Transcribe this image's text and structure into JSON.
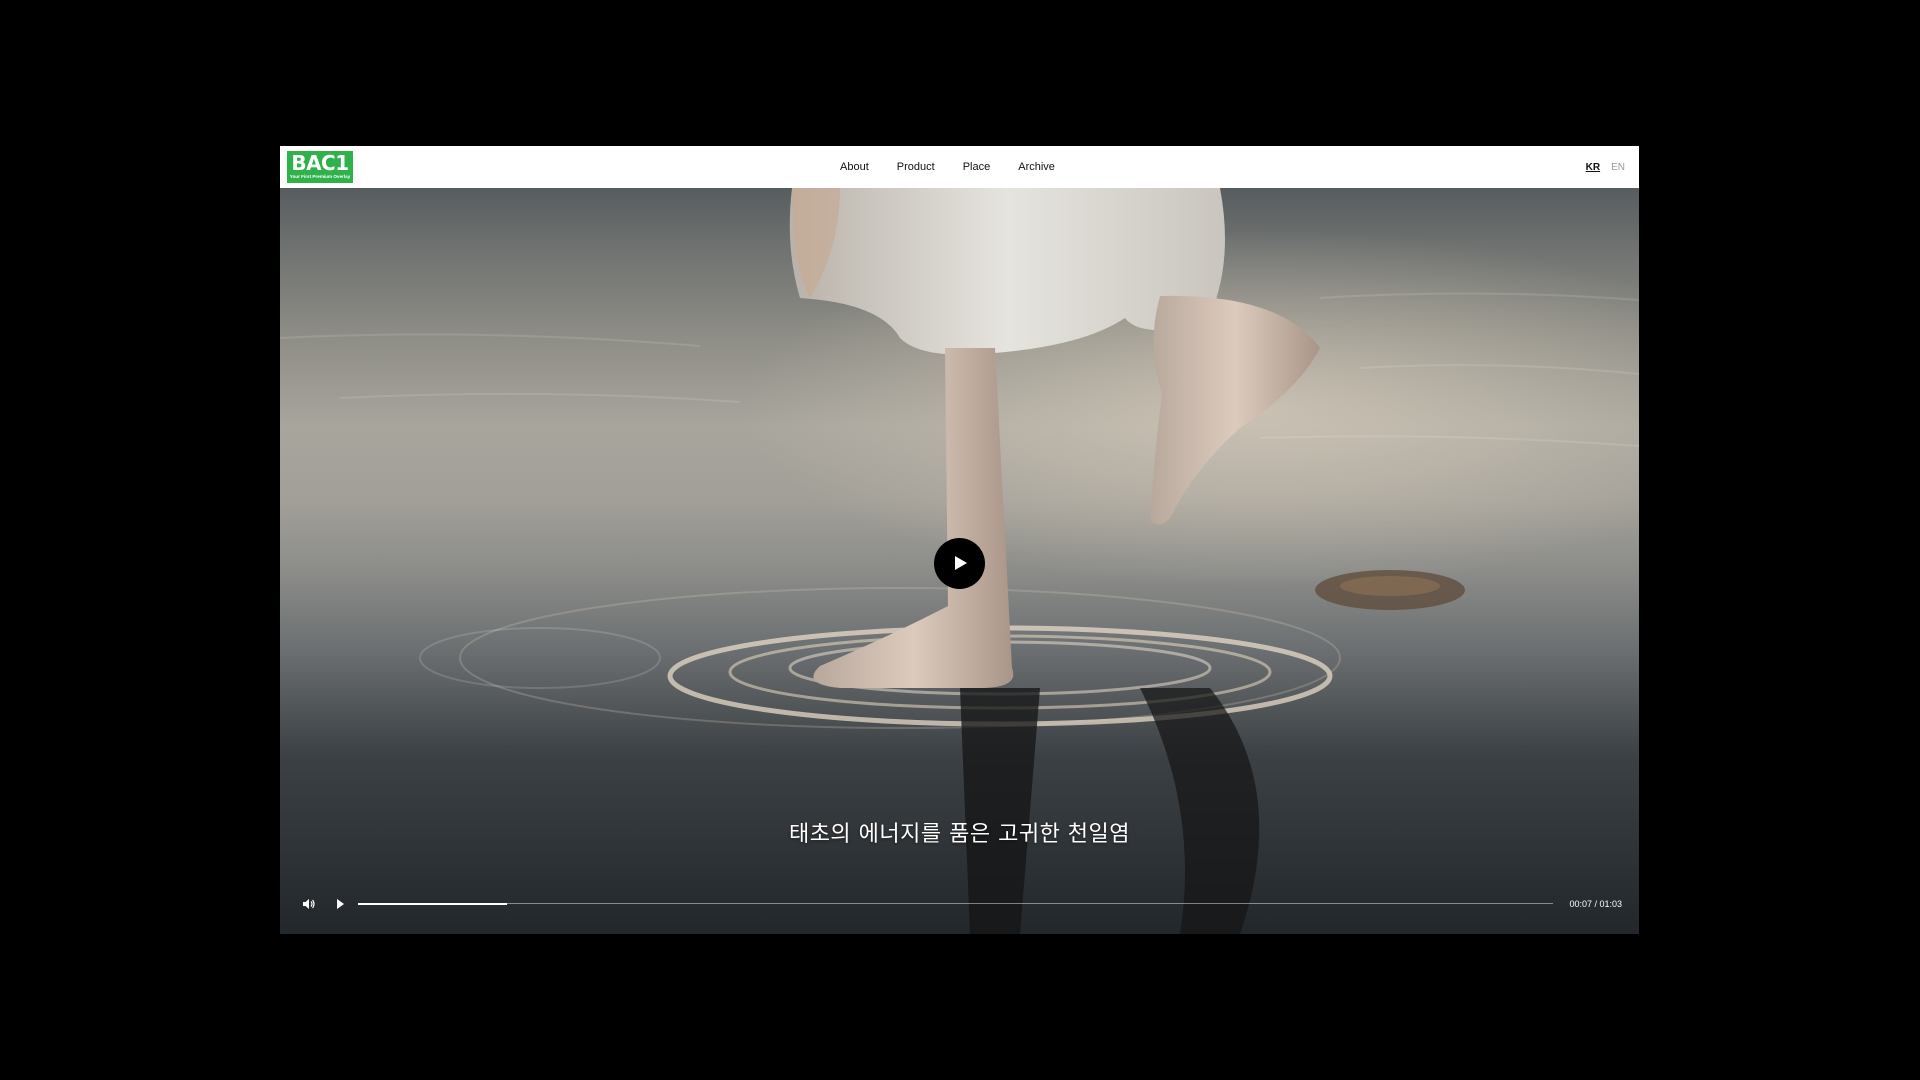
{
  "header": {
    "logo": {
      "text": "BAC1",
      "tagline": "Your First Premium Overlay"
    },
    "nav": [
      {
        "label": "About"
      },
      {
        "label": "Product"
      },
      {
        "label": "Place"
      },
      {
        "label": "Archive"
      }
    ],
    "languages": {
      "active": "KR",
      "inactive": "EN"
    }
  },
  "video": {
    "subtitle": "태초의 에너지를 품은 고귀한 천일염",
    "current_time": "00:07",
    "duration": "01:03",
    "time_display": "00:07 / 01:03",
    "progress_fraction": 0.125,
    "icons": {
      "center": "play-icon",
      "volume": "volume-icon",
      "play": "play-icon"
    }
  },
  "colors": {
    "brand_green": "#2fb24b",
    "background": "#000000",
    "header_bg": "#ffffff"
  }
}
